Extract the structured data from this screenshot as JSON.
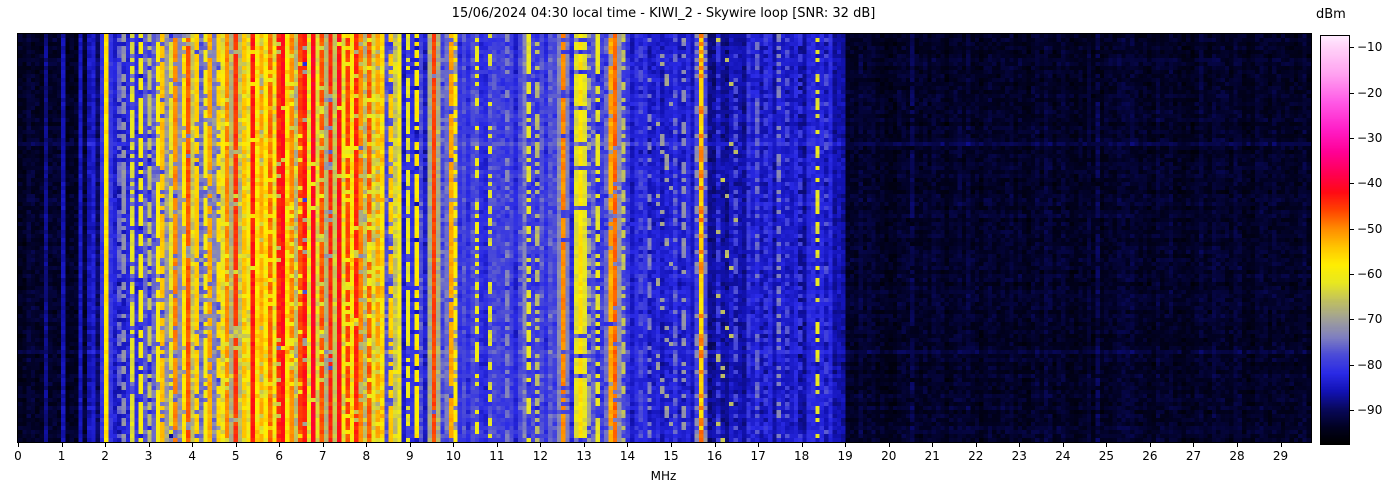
{
  "chart_data": {
    "type": "heatmap",
    "subtype": "radio-spectrum-waterfall",
    "title": "15/06/2024 04:30 local time - KIWI_2 - Skywire loop [SNR: 32 dB]",
    "xlabel": "MHz",
    "x_range_mhz": [
      0,
      29.7
    ],
    "x_tick_values": [
      0,
      1,
      2,
      3,
      4,
      5,
      6,
      7,
      8,
      9,
      10,
      11,
      12,
      13,
      14,
      15,
      16,
      17,
      18,
      19,
      20,
      21,
      22,
      23,
      24,
      25,
      26,
      27,
      28,
      29
    ],
    "x_tick_labels": [
      "0",
      "1",
      "2",
      "3",
      "4",
      "5",
      "6",
      "7",
      "8",
      "9",
      "10",
      "11",
      "12",
      "13",
      "14",
      "15",
      "16",
      "17",
      "18",
      "19",
      "20",
      "21",
      "22",
      "23",
      "24",
      "25",
      "26",
      "27",
      "28",
      "29"
    ],
    "colorbar": {
      "label": "dBm",
      "range_dbm": [
        -97.5,
        -7.5
      ],
      "tick_values": [
        -10,
        -20,
        -30,
        -40,
        -50,
        -60,
        -70,
        -80,
        -90
      ],
      "tick_labels": [
        "−10",
        "−20",
        "−30",
        "−40",
        "−50",
        "−60",
        "−70",
        "−80",
        "−90"
      ]
    },
    "colormap_stops": [
      [
        -97.5,
        "#000000"
      ],
      [
        -94,
        "#010120"
      ],
      [
        -90,
        "#08085a"
      ],
      [
        -86,
        "#1212b4"
      ],
      [
        -82,
        "#2a2ae6"
      ],
      [
        -78,
        "#4a4ad8"
      ],
      [
        -74,
        "#8080c0"
      ],
      [
        -70,
        "#a0a098"
      ],
      [
        -66,
        "#c0c060"
      ],
      [
        -62,
        "#e8e820"
      ],
      [
        -58,
        "#ffee02"
      ],
      [
        -54,
        "#ffc400"
      ],
      [
        -50,
        "#ff8c00"
      ],
      [
        -46,
        "#ff4400"
      ],
      [
        -42,
        "#ff0a14"
      ],
      [
        -38,
        "#ff0050"
      ],
      [
        -33,
        "#ff0096"
      ],
      [
        -28,
        "#ff1ec8"
      ],
      [
        -22,
        "#ff5ae6"
      ],
      [
        -16,
        "#ffa0f0"
      ],
      [
        -10,
        "#ffd2f8"
      ],
      [
        -7.5,
        "#ffeaff"
      ]
    ],
    "grid": {
      "cols": 300,
      "rows": 102
    },
    "noise_floor_dbm": -93.5,
    "bands": [
      {
        "from": 0.0,
        "to": 1.6,
        "base": -93.5,
        "col_var": 1.3,
        "row_noise": 1.9
      },
      {
        "from": 1.6,
        "to": 1.8,
        "base": -86,
        "col_var": 2.0,
        "row_noise": 2.0
      },
      {
        "from": 1.8,
        "to": 2.02,
        "base": -90,
        "col_var": 2.0,
        "row_noise": 2.0
      },
      {
        "from": 2.02,
        "to": 2.55,
        "base": -84,
        "col_var": 3.0,
        "row_noise": 2.5
      },
      {
        "from": 2.55,
        "to": 3.15,
        "base": -79,
        "col_var": 5.0,
        "row_noise": 3.0
      },
      {
        "from": 3.15,
        "to": 4.7,
        "base": -71,
        "col_var": 7.0,
        "row_noise": 4.0,
        "gap_frac": 0.12,
        "gap_drop": 10
      },
      {
        "from": 4.7,
        "to": 8.8,
        "base": -63,
        "col_var": 7.0,
        "row_noise": 4.5,
        "gap_frac": 0.14,
        "gap_drop": 14
      },
      {
        "from": 8.8,
        "to": 9.4,
        "base": -81,
        "col_var": 4.0,
        "row_noise": 3.0
      },
      {
        "from": 9.4,
        "to": 10.1,
        "base": -74,
        "col_var": 6.0,
        "row_noise": 4.0
      },
      {
        "from": 10.1,
        "to": 11.6,
        "base": -80.5,
        "col_var": 3.0,
        "row_noise": 2.6
      },
      {
        "from": 11.6,
        "to": 12.2,
        "base": -78,
        "col_var": 4.0,
        "row_noise": 3.0
      },
      {
        "from": 12.2,
        "to": 14.1,
        "base": -78.5,
        "col_var": 4.0,
        "row_noise": 3.0
      },
      {
        "from": 14.1,
        "to": 15.45,
        "base": -84,
        "col_var": 3.0,
        "row_noise": 2.4
      },
      {
        "from": 15.45,
        "to": 16.6,
        "base": -87,
        "col_var": 2.0,
        "row_noise": 2.0
      },
      {
        "from": 16.6,
        "to": 19.0,
        "base": -85,
        "col_var": 2.6,
        "row_noise": 2.2
      },
      {
        "from": 19.0,
        "to": 29.7,
        "base": -93.5,
        "col_var": 1.1,
        "row_noise": 1.9
      }
    ],
    "signals": [
      {
        "f": 0.63,
        "dbm": -88,
        "duty": 1
      },
      {
        "f": 1.0,
        "dbm": -86,
        "duty": 1
      },
      {
        "f": 1.43,
        "dbm": -85,
        "duty": 1
      },
      {
        "f": 2.05,
        "dbm": -57,
        "duty": 1
      },
      {
        "f": 2.3,
        "dbm": -76,
        "duty": 0.6
      },
      {
        "f": 2.45,
        "dbm": -72,
        "duty": 0.6
      },
      {
        "f": 2.63,
        "dbm": -63,
        "duty": 0.75
      },
      {
        "f": 2.8,
        "dbm": -60,
        "duty": 0.6
      },
      {
        "f": 2.97,
        "dbm": -66,
        "duty": 0.6
      },
      {
        "f": 3.2,
        "dbm": -59,
        "duty": 0.85
      },
      {
        "f": 3.33,
        "dbm": -54,
        "duty": 0.8
      },
      {
        "f": 3.5,
        "dbm": -62,
        "duty": 0.8
      },
      {
        "f": 3.65,
        "dbm": -50,
        "duty": 0.85
      },
      {
        "f": 3.8,
        "dbm": -57,
        "duty": 0.8
      },
      {
        "f": 3.95,
        "dbm": -47,
        "duty": 0.9
      },
      {
        "f": 4.1,
        "dbm": -55,
        "duty": 0.8
      },
      {
        "f": 4.27,
        "dbm": -60,
        "duty": 0.7
      },
      {
        "f": 4.42,
        "dbm": -52,
        "duty": 0.8
      },
      {
        "f": 4.6,
        "dbm": -56,
        "duty": 0.75
      },
      {
        "f": 4.85,
        "dbm": -50,
        "duty": 0.85
      },
      {
        "f": 5.0,
        "dbm": -45,
        "duty": 0.9
      },
      {
        "f": 5.15,
        "dbm": -54,
        "duty": 0.8
      },
      {
        "f": 5.36,
        "dbm": -43,
        "duty": 0.95
      },
      {
        "f": 5.55,
        "dbm": -52,
        "duty": 0.8
      },
      {
        "f": 5.75,
        "dbm": -48,
        "duty": 0.85
      },
      {
        "f": 5.95,
        "dbm": -44,
        "duty": 0.9
      },
      {
        "f": 6.07,
        "dbm": -42,
        "duty": 0.95
      },
      {
        "f": 6.25,
        "dbm": -50,
        "duty": 0.8
      },
      {
        "f": 6.45,
        "dbm": -46,
        "duty": 0.85
      },
      {
        "f": 6.62,
        "dbm": -43,
        "duty": 0.9
      },
      {
        "f": 6.8,
        "dbm": -41,
        "duty": 0.95
      },
      {
        "f": 7.0,
        "dbm": -47,
        "duty": 0.85
      },
      {
        "f": 7.2,
        "dbm": -44,
        "duty": 0.9
      },
      {
        "f": 7.35,
        "dbm": -42,
        "duty": 0.95
      },
      {
        "f": 7.55,
        "dbm": -46,
        "duty": 0.85
      },
      {
        "f": 7.75,
        "dbm": -44,
        "duty": 0.9
      },
      {
        "f": 7.9,
        "dbm": -50,
        "duty": 0.8
      },
      {
        "f": 8.1,
        "dbm": -47,
        "duty": 0.8
      },
      {
        "f": 8.3,
        "dbm": -52,
        "duty": 0.75
      },
      {
        "f": 8.55,
        "dbm": -55,
        "duty": 0.7
      },
      {
        "f": 8.95,
        "dbm": -62,
        "duty": 0.7
      },
      {
        "f": 9.14,
        "dbm": -58,
        "duty": 0.8
      },
      {
        "f": 9.55,
        "dbm": -46,
        "duty": 0.98
      },
      {
        "f": 9.9,
        "dbm": -52,
        "duty": 0.9
      },
      {
        "f": 10.05,
        "dbm": -58,
        "duty": 0.7
      },
      {
        "f": 10.5,
        "dbm": -61,
        "duty": 0.5
      },
      {
        "f": 10.85,
        "dbm": -63,
        "duty": 0.45
      },
      {
        "f": 11.2,
        "dbm": -74,
        "duty": 0.5
      },
      {
        "f": 11.72,
        "dbm": -62,
        "duty": 0.6
      },
      {
        "f": 11.9,
        "dbm": -67,
        "duty": 0.5
      },
      {
        "f": 12.56,
        "dbm": -50,
        "duty": 0.92
      },
      {
        "f": 12.87,
        "dbm": -57,
        "duty": 0.85,
        "w": 0.1
      },
      {
        "f": 13.1,
        "dbm": -70,
        "duty": 0.5
      },
      {
        "f": 13.3,
        "dbm": -62,
        "duty": 0.6
      },
      {
        "f": 13.57,
        "dbm": -52,
        "duty": 0.85
      },
      {
        "f": 13.72,
        "dbm": -48,
        "duty": 0.9
      },
      {
        "f": 13.9,
        "dbm": -66,
        "duty": 0.5
      },
      {
        "f": 14.3,
        "dbm": -78,
        "duty": 0.5
      },
      {
        "f": 14.55,
        "dbm": -74,
        "duty": 0.4
      },
      {
        "f": 14.85,
        "dbm": -70,
        "duty": 0.35,
        "slant": {
          "amp": 0.3,
          "period": 20
        }
      },
      {
        "f": 15.05,
        "dbm": -76,
        "duty": 0.4
      },
      {
        "f": 15.25,
        "dbm": -72,
        "duty": 0.4
      },
      {
        "f": 15.66,
        "dbm": -56,
        "duty": 1
      },
      {
        "f": 15.66,
        "dbm": -49,
        "duty": 0.3
      },
      {
        "f": 16.05,
        "dbm": -80,
        "duty": 0.5
      },
      {
        "f": 16.3,
        "dbm": -66,
        "duty": 0.3,
        "slant": {
          "amp": 0.45,
          "period": 16
        }
      },
      {
        "f": 16.5,
        "dbm": -78,
        "duty": 0.4
      },
      {
        "f": 16.75,
        "dbm": -80,
        "duty": 0.6
      },
      {
        "f": 17.0,
        "dbm": -76,
        "duty": 0.5
      },
      {
        "f": 17.2,
        "dbm": -80,
        "duty": 0.5
      },
      {
        "f": 17.45,
        "dbm": -74,
        "duty": 0.5
      },
      {
        "f": 17.7,
        "dbm": -78,
        "duty": 0.4
      },
      {
        "f": 18.0,
        "dbm": -80,
        "duty": 0.45
      },
      {
        "f": 18.4,
        "dbm": -62,
        "duty": 0.55
      },
      {
        "f": 18.6,
        "dbm": -78,
        "duty": 0.4
      },
      {
        "f": 20.5,
        "dbm": -90.5,
        "duty": 0.8
      },
      {
        "f": 24.8,
        "dbm": -90.5,
        "duty": 0.7
      }
    ],
    "bright_rows": [
      {
        "row": 27,
        "boost_db": 2.0
      },
      {
        "row": 79,
        "boost_db": 2.0
      }
    ],
    "legend": "none",
    "grid_lines": "off"
  }
}
